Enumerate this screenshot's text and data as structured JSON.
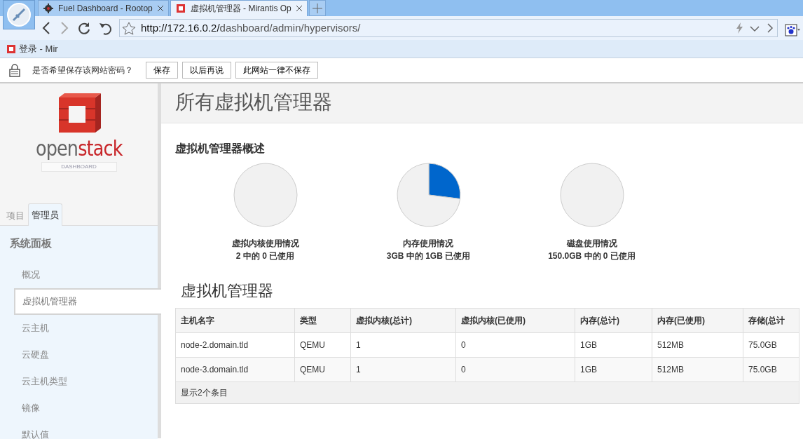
{
  "browser": {
    "tabs": [
      {
        "title": "Fuel Dashboard - Rootop",
        "selected": false
      },
      {
        "title": "虚拟机管理器 - Mirantis Op",
        "selected": true
      }
    ],
    "address": {
      "host": "http://172.16.0.2/",
      "path": "dashboard/admin/hypervisors/"
    },
    "bookmarks": [
      {
        "label": "登录 - Mir"
      }
    ],
    "password_bar": {
      "prompt": "是否希望保存该网站密码？",
      "buttons": [
        "保存",
        "以后再说",
        "此网站一律不保存"
      ]
    }
  },
  "sidebar": {
    "logo": {
      "word_1": "open",
      "word_2": "stack",
      "subtitle": "DASHBOARD"
    },
    "tabs": [
      {
        "label": "项目",
        "selected": false
      },
      {
        "label": "管理员",
        "selected": true
      }
    ],
    "section": "系统面板",
    "items": [
      {
        "label": "概况",
        "selected": false
      },
      {
        "label": "虚拟机管理器",
        "selected": true
      },
      {
        "label": "云主机",
        "selected": false
      },
      {
        "label": "云硬盘",
        "selected": false
      },
      {
        "label": "云主机类型",
        "selected": false
      },
      {
        "label": "镜像",
        "selected": false
      },
      {
        "label": "默认值",
        "selected": false
      }
    ]
  },
  "page_title": "所有虚拟机管理器",
  "overview": {
    "title": "虚拟机管理器概述",
    "pies": [
      {
        "label": "虚拟内核使用情况",
        "detail": "2 中的 0 已使用",
        "chart_data": {
          "type": "pie",
          "values": [
            0,
            100
          ]
        }
      },
      {
        "label": "内存使用情况",
        "detail": "3GB 中的 1GB 已使用",
        "chart_data": {
          "type": "pie",
          "values": [
            27,
            73
          ]
        }
      },
      {
        "label": "磁盘使用情况",
        "detail": "150.0GB 中的 0 已使用",
        "chart_data": {
          "type": "pie",
          "values": [
            0,
            100
          ]
        }
      }
    ]
  },
  "table": {
    "title": "虚拟机管理器",
    "columns": [
      "主机名字",
      "类型",
      "虚拟内核(总计)",
      "虚拟内核(已使用)",
      "内存(总计)",
      "内存(已使用)",
      "存储(总计"
    ],
    "rows": [
      [
        "node-2.domain.tld",
        "QEMU",
        "1",
        "0",
        "1GB",
        "512MB",
        "75.0GB"
      ],
      [
        "node-3.domain.tld",
        "QEMU",
        "1",
        "0",
        "1GB",
        "512MB",
        "75.0GB"
      ]
    ],
    "footer": "显示2个条目"
  }
}
